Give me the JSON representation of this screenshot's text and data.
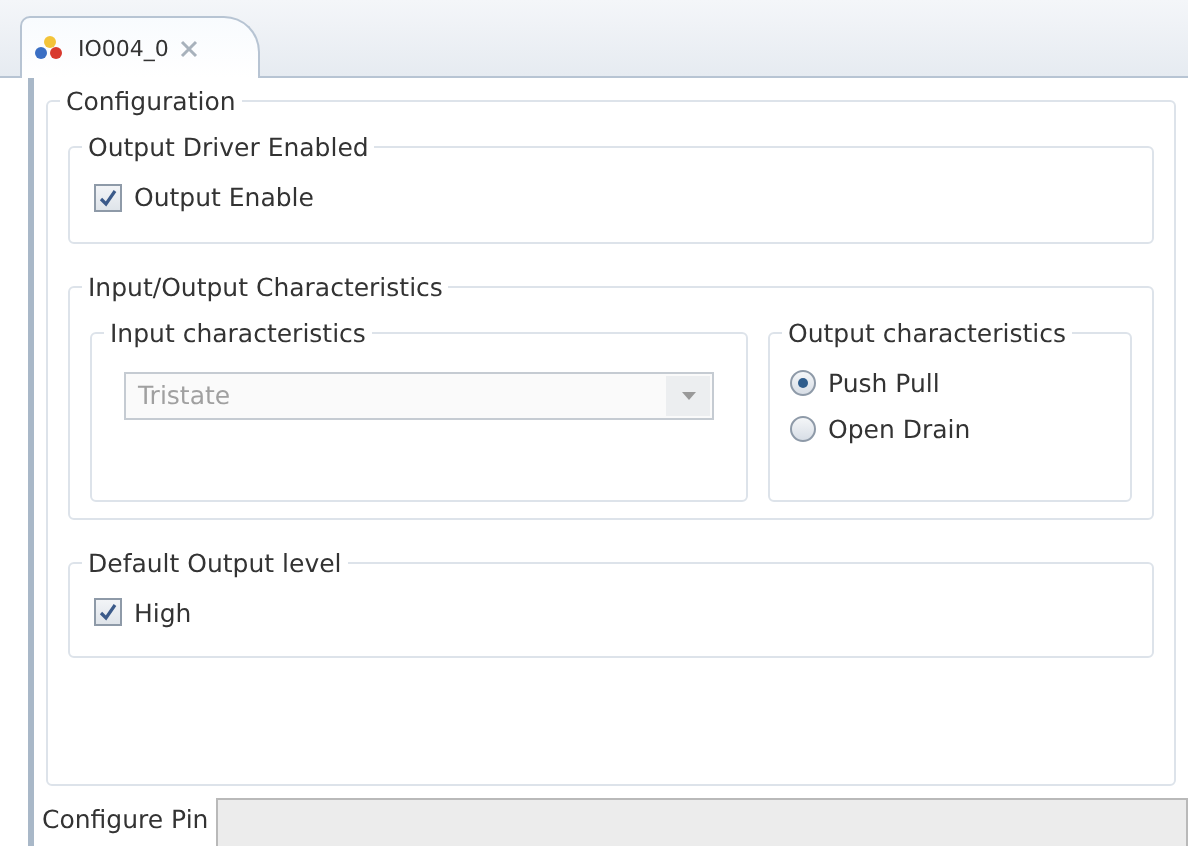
{
  "editor_tab": {
    "label": "IO004_0",
    "selected": true
  },
  "configuration": {
    "legend": "Configuration",
    "output_driver": {
      "legend": "Output Driver Enabled",
      "checkbox": {
        "label": "Output Enable",
        "checked": true
      }
    },
    "io_characteristics": {
      "legend": "Input/Output Characteristics",
      "input": {
        "legend": "Input characteristics",
        "dropdown": {
          "value": "Tristate",
          "disabled": true
        }
      },
      "output": {
        "legend": "Output characteristics",
        "options": [
          {
            "label": "Push Pull",
            "selected": true
          },
          {
            "label": "Open Drain",
            "selected": false
          }
        ]
      }
    },
    "default_output_level": {
      "legend": "Default Output level",
      "checkbox": {
        "label": "High",
        "checked": true
      }
    }
  },
  "bottom_tabs": [
    {
      "label": "Configure Pin",
      "selected": true
    }
  ]
}
